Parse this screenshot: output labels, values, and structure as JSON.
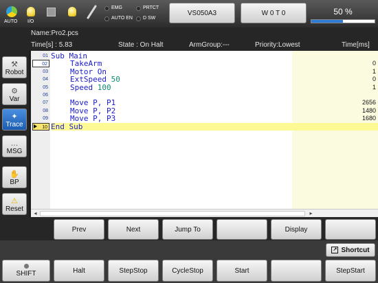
{
  "toolbar": {
    "auto_label": "AUTO",
    "io_label": "I/O",
    "status": {
      "emg": "EMG",
      "prtct": "PRTCT",
      "auto_en": "AUTO EN",
      "dsw": "D SW"
    },
    "robot_button": "VS050A3",
    "tool_button": "W 0 T 0",
    "speed_text": "50 %",
    "speed_percent": 50
  },
  "program": {
    "name": "Name:Pro2.pcs",
    "time": "Time[s] : 5.83",
    "state": "State : On Halt",
    "arm_group": "ArmGroup:---",
    "priority": "Priority:Lowest",
    "time_col_header": "Time[ms]"
  },
  "sidebar": {
    "items": [
      {
        "label": "Robot"
      },
      {
        "label": "Var"
      },
      {
        "label": "Trace"
      },
      {
        "label": "MSG"
      },
      {
        "label": "BP"
      },
      {
        "label": "Reset"
      }
    ]
  },
  "editor": {
    "lines": [
      {
        "num": "01",
        "kw": "Sub Main",
        "arg": "",
        "time": ""
      },
      {
        "num": "02",
        "kw": "TakeArm",
        "arg": "",
        "time": "0"
      },
      {
        "num": "03",
        "kw": "Motor On",
        "arg": "",
        "time": "1"
      },
      {
        "num": "04",
        "kw": "ExtSpeed",
        "arg": "50",
        "time": "0"
      },
      {
        "num": "05",
        "kw": "Speed",
        "arg": "100",
        "time": "1"
      },
      {
        "num": "06",
        "kw": "",
        "arg": "",
        "time": ""
      },
      {
        "num": "07",
        "kw": "Move P, P1",
        "arg": "",
        "time": "2656"
      },
      {
        "num": "08",
        "kw": "Move P, P2",
        "arg": "",
        "time": "1480"
      },
      {
        "num": "09",
        "kw": "Move P, P3",
        "arg": "",
        "time": "1680"
      },
      {
        "num": "10",
        "kw": "End Sub",
        "arg": "",
        "time": ""
      }
    ]
  },
  "nav_keys": [
    "Prev",
    "Next",
    "Jump To",
    "",
    "Display",
    ""
  ],
  "shortcut_label": "Shortcut",
  "exec_keys": [
    "SHIFT",
    "Halt",
    "StepStop",
    "CycleStop",
    "Start",
    "",
    "StepStart"
  ]
}
